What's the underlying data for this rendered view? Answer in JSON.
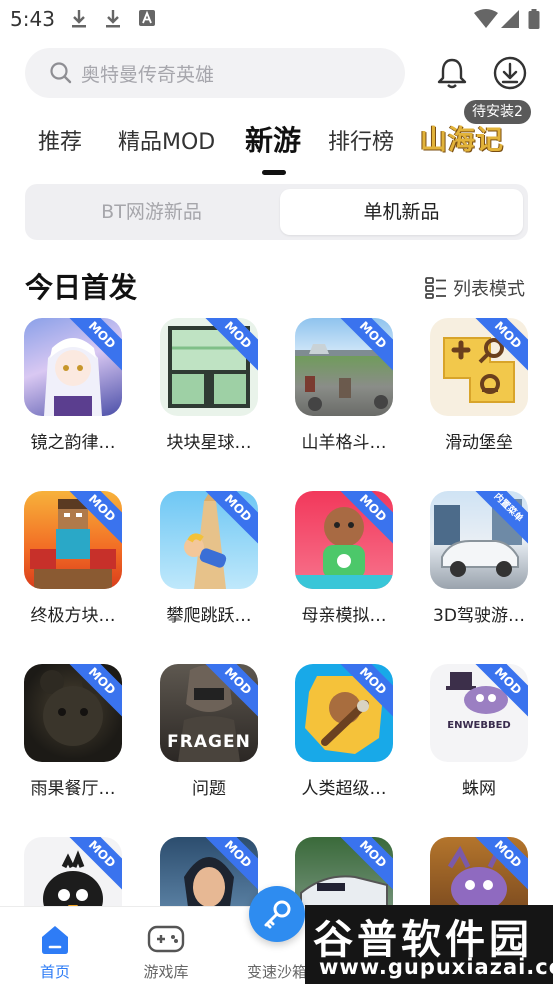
{
  "status_bar": {
    "time": "5:43"
  },
  "search": {
    "placeholder": "奥特曼传奇英雄"
  },
  "header": {
    "pending_badge": "待安装2"
  },
  "tabs": [
    {
      "label": "推荐"
    },
    {
      "label": "精品MOD"
    },
    {
      "label": "新游"
    },
    {
      "label": "排行榜"
    }
  ],
  "promo_tab": {
    "label": "山海记"
  },
  "segment": {
    "left": "BT网游新品",
    "right": "单机新品"
  },
  "section": {
    "title": "今日首发",
    "list_mode": "列表模式"
  },
  "ribbons": {
    "mod": "MOD",
    "built_in": "内置菜单"
  },
  "apps": [
    {
      "name": "镜之韵律…",
      "ribbon": "MOD"
    },
    {
      "name": "块块星球…",
      "ribbon": "MOD"
    },
    {
      "name": "山羊格斗…",
      "ribbon": "MOD"
    },
    {
      "name": "滑动堡垒",
      "ribbon": "MOD"
    },
    {
      "name": "终极方块…",
      "ribbon": "MOD"
    },
    {
      "name": "攀爬跳跃…",
      "ribbon": "MOD"
    },
    {
      "name": "母亲模拟…",
      "ribbon": "MOD"
    },
    {
      "name": "3D驾驶游…",
      "ribbon": "内置菜单"
    },
    {
      "name": "雨果餐厅…",
      "ribbon": "MOD"
    },
    {
      "name": "问题",
      "ribbon": "MOD",
      "art_text": "FRAGEN"
    },
    {
      "name": "人类超级…",
      "ribbon": "MOD"
    },
    {
      "name": "蛛网",
      "ribbon": "MOD",
      "art_text": "ENWEBBED"
    },
    {
      "name": "",
      "ribbon": "MOD"
    },
    {
      "name": "",
      "ribbon": "MOD"
    },
    {
      "name": "",
      "ribbon": "MOD"
    },
    {
      "name": "",
      "ribbon": "MOD"
    }
  ],
  "bottom_nav": [
    {
      "label": "首页"
    },
    {
      "label": "游戏库"
    },
    {
      "label": "变速沙箱"
    }
  ],
  "watermark": {
    "line1": "谷普软件园",
    "line2": "www.gupuxiazai.com"
  },
  "colors": {
    "accent": "#2e7cf6",
    "ribbon": "#3a73ee",
    "promo": "#e2b33a"
  }
}
